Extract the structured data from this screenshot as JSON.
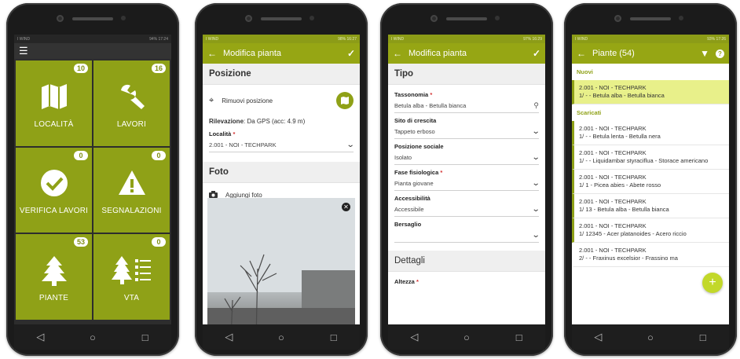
{
  "colors": {
    "accent": "#96a614",
    "tile": "#8fa117",
    "selected_row": "#e8f08a"
  },
  "nav": {
    "back": "◁",
    "home": "○",
    "recents": "□"
  },
  "screen1": {
    "status_left": "I WIND",
    "status_right": "94% 17:24",
    "menu_icon": "☰",
    "tiles": [
      {
        "label": "LOCALITÀ",
        "badge": "10",
        "icon": "map-icon"
      },
      {
        "label": "LAVORI",
        "badge": "16",
        "icon": "wrench-icon"
      },
      {
        "label": "VERIFICA LAVORI",
        "badge": "0",
        "icon": "check-icon"
      },
      {
        "label": "SEGNALAZIONI",
        "badge": "0",
        "icon": "warning-icon"
      },
      {
        "label": "PIANTE",
        "badge": "53",
        "icon": "tree-icon"
      },
      {
        "label": "VTA",
        "badge": "0",
        "icon": "tree-list-icon"
      }
    ]
  },
  "screen2": {
    "status_left": "I WIND",
    "status_right": "98% 16:27",
    "title": "Modifica pianta",
    "section_position": "Posizione",
    "remove_position": "Rimuovi posizione",
    "detection_label": "Rilevazione",
    "detection_value": ": Da GPS (acc: 4.9 m)",
    "locality_label": "Località",
    "locality_value": "2.001 - NOI - TECHPARK",
    "section_photo": "Foto",
    "add_photo": "Aggiungi foto"
  },
  "screen3": {
    "status_left": "I WIND",
    "status_right": "97% 16:29",
    "title": "Modifica pianta",
    "section_type": "Tipo",
    "taxonomy_label": "Tassonomia",
    "taxonomy_value": "Betula alba - Betulla bianca",
    "site_label": "Sito di crescita",
    "site_value": "Tappeto erboso",
    "social_label": "Posizione sociale",
    "social_value": "Isolato",
    "phase_label": "Fase fisiologica",
    "phase_value": "Pianta giovane",
    "access_label": "Accessibilità",
    "access_value": "Accessibile",
    "target_label": "Bersaglio",
    "target_value": "",
    "section_details": "Dettagli",
    "height_label": "Altezza"
  },
  "screen4": {
    "status_left": "I WIND",
    "status_right": "93% 17:26",
    "title": "Piante (54)",
    "group_new": "Nuovi",
    "group_downloaded": "Scaricati",
    "new_items": [
      {
        "line1": "2.001 - NOI - TECHPARK",
        "line2": "1/ - - Betula alba - Betulla bianca"
      }
    ],
    "items": [
      {
        "line1": "2.001 - NOI - TECHPARK",
        "line2": "1/ - - Betula lenta - Betulla nera"
      },
      {
        "line1": "2.001 - NOI - TECHPARK",
        "line2": "1/ - - Liquidambar styraciflua - Storace americano"
      },
      {
        "line1": "2.001 - NOI - TECHPARK",
        "line2": "1/ 1 - Picea abies - Abete rosso"
      },
      {
        "line1": "2.001 - NOI - TECHPARK",
        "line2": "1/ 13 - Betula alba - Betulla bianca"
      },
      {
        "line1": "2.001 - NOI - TECHPARK",
        "line2": "1/ 12345 - Acer platanoides - Acero riccio"
      },
      {
        "line1": "2.001 - NOI - TECHPARK",
        "line2": "2/ - - Fraxinus excelsior - Frassino ma"
      }
    ],
    "fab": "+"
  }
}
